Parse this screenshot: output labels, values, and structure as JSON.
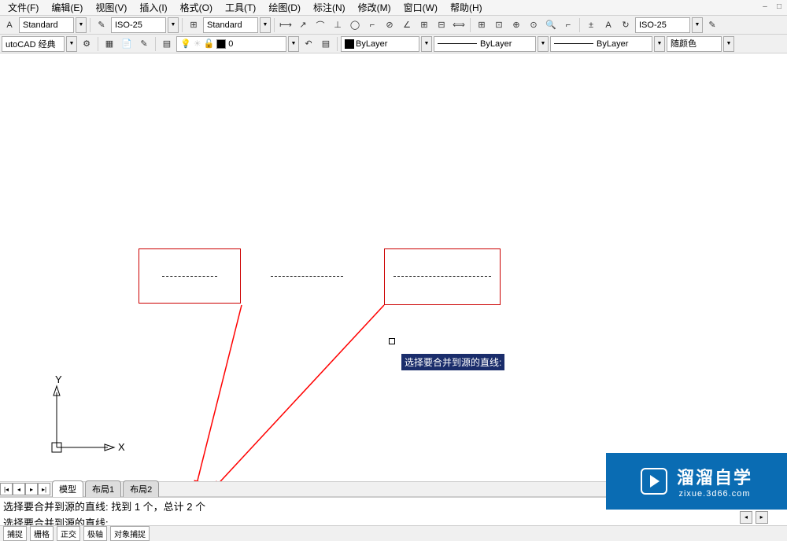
{
  "menu": {
    "items": [
      "文件(F)",
      "编辑(E)",
      "视图(V)",
      "插入(I)",
      "格式(O)",
      "工具(T)",
      "绘图(D)",
      "标注(N)",
      "修改(M)",
      "窗口(W)",
      "帮助(H)"
    ]
  },
  "toolbar1": {
    "textstyle": "Standard",
    "dimstyle": "ISO-25",
    "tablestyle": "Standard",
    "dimstyle2": "ISO-25"
  },
  "toolbar2": {
    "workspace": "utoCAD 经典",
    "layer_name": "0",
    "color_label": "ByLayer",
    "linetype_label": "ByLayer",
    "lineweight_label": "ByLayer",
    "plotstyle_label": "随颜色"
  },
  "prompt": {
    "tooltip": "选择要合并到源的直线:"
  },
  "ucs": {
    "x": "X",
    "y": "Y"
  },
  "tabs": {
    "model": "模型",
    "layout1": "布局1",
    "layout2": "布局2"
  },
  "cmd": {
    "line1": "选择要合并到源的直线:  找到 1 个，总计 2 个",
    "line2": "选择要合并到源的直线:"
  },
  "watermark": {
    "cn": "溜溜自学",
    "en": "zixue.3d66.com"
  },
  "colors": {
    "selection": "#c00",
    "tooltip_bg": "#1a2d6b",
    "brand": "#0a6cb3",
    "arrow": "#ff0000"
  }
}
